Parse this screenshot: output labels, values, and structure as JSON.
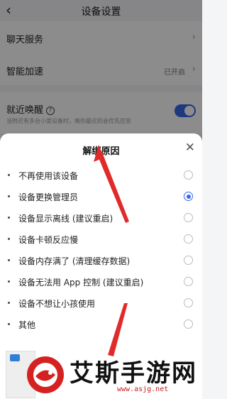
{
  "settings": {
    "title": "设备设置",
    "rows": [
      {
        "label": "聊天服务",
        "value": ""
      },
      {
        "label": "智能加速",
        "value": "已开启"
      },
      {
        "label": "就近唤醒",
        "value": ""
      }
    ],
    "nearby_desc": "当附近有多台小度设备时，离你最近的会优先应答",
    "nearby_toggle_on": true
  },
  "sheet": {
    "title": "解绑原因",
    "options": [
      {
        "label": "不再使用该设备",
        "selected": false
      },
      {
        "label": "设备更换管理员",
        "selected": true
      },
      {
        "label": "设备显示离线 (建议重启)",
        "selected": false
      },
      {
        "label": "设备卡顿反应慢",
        "selected": false
      },
      {
        "label": "设备内存满了 (清理缓存数据)",
        "selected": false
      },
      {
        "label": "设备无法用 App 控制 (建议重启)",
        "selected": false
      },
      {
        "label": "设备不想让小孩使用",
        "selected": false
      },
      {
        "label": "其他",
        "selected": false
      }
    ]
  },
  "watermark": {
    "text": "艾斯手游网",
    "url": "www.asjg.net"
  },
  "colors": {
    "accent": "#3a67e8",
    "arrow": "#e12b2b"
  }
}
